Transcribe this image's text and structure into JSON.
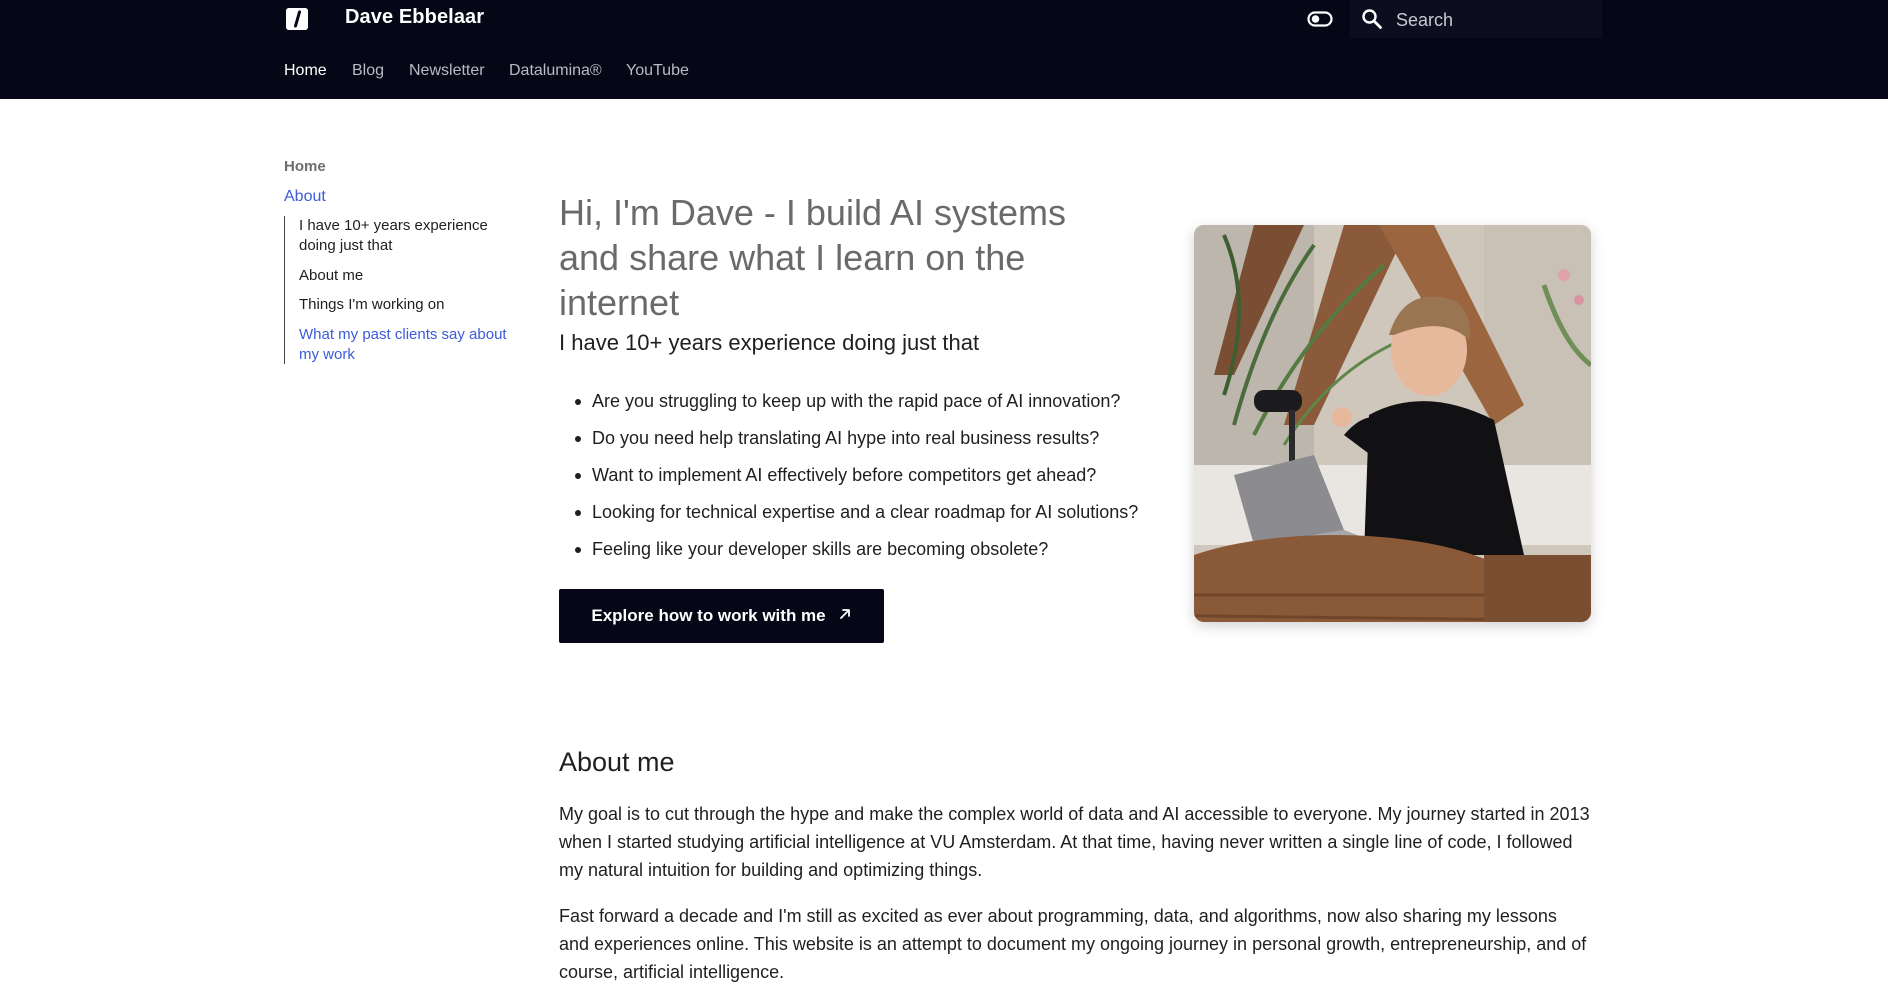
{
  "header": {
    "site_title": "Dave Ebbelaar",
    "logo_icon": "slash-logo-icon",
    "theme_toggle_icon": "toggle-switch-icon",
    "search": {
      "placeholder": "Search",
      "value": "",
      "icon": "search-icon"
    },
    "tabs": [
      {
        "label": "Home",
        "active": true
      },
      {
        "label": "Blog",
        "active": false
      },
      {
        "label": "Newsletter",
        "active": false
      },
      {
        "label": "Datalumina®",
        "active": false
      },
      {
        "label": "YouTube",
        "active": false
      }
    ]
  },
  "sidebar": {
    "home_label": "Home",
    "about_label": "About",
    "toc": [
      {
        "label": "I have 10+ years experience doing just that",
        "active": false
      },
      {
        "label": "About me",
        "active": false
      },
      {
        "label": "Things I'm working on",
        "active": false
      },
      {
        "label": "What my past clients say about my work",
        "active": true
      }
    ]
  },
  "main": {
    "hero_title": "Hi, I'm Dave - I build AI systems and share what I learn on the internet",
    "experience_heading": "I have 10+ years experience doing just that",
    "bullets": [
      "Are you struggling to keep up with the rapid pace of AI innovation?",
      "Do you need help translating AI hype into real business results?",
      "Want to implement AI effectively before competitors get ahead?",
      "Looking for technical expertise and a clear roadmap for AI solutions?",
      "Feeling like your developer skills are becoming obsolete?"
    ],
    "cta_label": "Explore how to work with me",
    "cta_icon": "arrow-up-right-icon",
    "about_heading": "About me",
    "paragraphs": [
      "My goal is to cut through the hype and make the complex world of data and AI accessible to everyone. My journey started in 2013 when I started studying artificial intelligence at VU Amsterdam. At that time, having never written a single line of code, I followed my natural intuition for building and optimizing things.",
      "Fast forward a decade and I'm still as excited as ever about programming, data, and algorithms, now also sharing my lessons and experiences online. This website is an attempt to document my ongoing journey in personal growth, entrepreneurship, and of course, artificial intelligence."
    ]
  },
  "colors": {
    "header_bg": "#050716",
    "accent_link": "#3b5bdb",
    "button_bg": "#050716"
  }
}
